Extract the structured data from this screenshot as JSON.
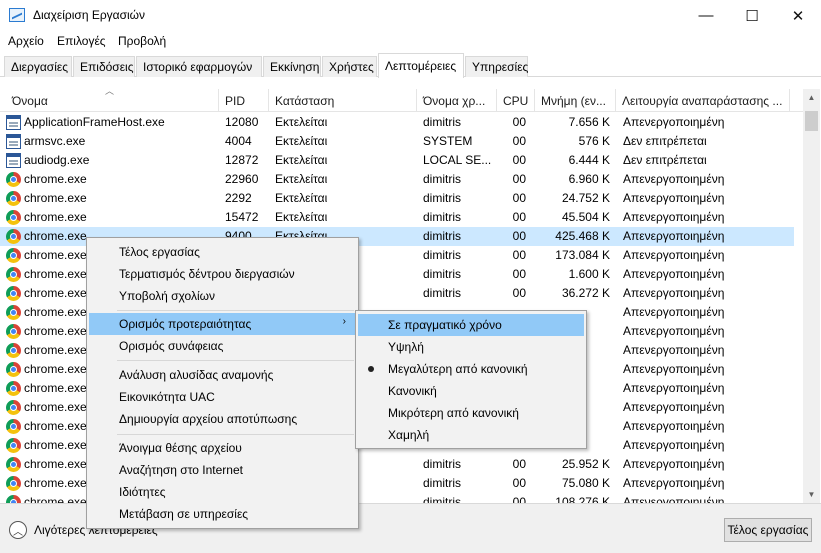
{
  "window": {
    "title": "Διαχείριση Εργασιών",
    "minimize": "—",
    "maximize": "☐",
    "close": "✕"
  },
  "menu": [
    "Αρχείο",
    "Επιλογές",
    "Προβολή"
  ],
  "tabs": [
    {
      "label": "Διεργασίες",
      "active": false
    },
    {
      "label": "Επιδόσεις",
      "active": false
    },
    {
      "label": "Ιστορικό εφαρμογών",
      "active": false
    },
    {
      "label": "Εκκίνηση",
      "active": false
    },
    {
      "label": "Χρήστες",
      "active": false
    },
    {
      "label": "Λεπτομέρειες",
      "active": true
    },
    {
      "label": "Υπηρεσίες",
      "active": false
    }
  ],
  "columns": [
    "Όνομα",
    "PID",
    "Κατάσταση",
    "Όνομα χρ...",
    "CPU",
    "Μνήμη (εν...",
    "Λειτουργία αναπαράστασης ..."
  ],
  "rows": [
    {
      "icon": "window-app-icon",
      "name": "ApplicationFrameHost.exe",
      "pid": "12080",
      "status": "Εκτελείται",
      "user": "dimitris",
      "cpu": "00",
      "mem": "7.656 K",
      "mode": "Απενεργοποιημένη"
    },
    {
      "icon": "window-app-icon",
      "name": "armsvc.exe",
      "pid": "4004",
      "status": "Εκτελείται",
      "user": "SYSTEM",
      "cpu": "00",
      "mem": "576 K",
      "mode": "Δεν επιτρέπεται"
    },
    {
      "icon": "window-app-icon",
      "name": "audiodg.exe",
      "pid": "12872",
      "status": "Εκτελείται",
      "user": "LOCAL SE...",
      "cpu": "00",
      "mem": "6.444 K",
      "mode": "Δεν επιτρέπεται"
    },
    {
      "icon": "chrome-icon",
      "name": "chrome.exe",
      "pid": "22960",
      "status": "Εκτελείται",
      "user": "dimitris",
      "cpu": "00",
      "mem": "6.960 K",
      "mode": "Απενεργοποιημένη"
    },
    {
      "icon": "chrome-icon",
      "name": "chrome.exe",
      "pid": "2292",
      "status": "Εκτελείται",
      "user": "dimitris",
      "cpu": "00",
      "mem": "24.752 K",
      "mode": "Απενεργοποιημένη"
    },
    {
      "icon": "chrome-icon",
      "name": "chrome.exe",
      "pid": "15472",
      "status": "Εκτελείται",
      "user": "dimitris",
      "cpu": "00",
      "mem": "45.504 K",
      "mode": "Απενεργοποιημένη"
    },
    {
      "icon": "chrome-icon",
      "name": "chrome.exe",
      "pid": "9400",
      "status": "Εκτελείται",
      "user": "dimitris",
      "cpu": "00",
      "mem": "425.468 K",
      "mode": "Απενεργοποιημένη",
      "selected": true
    },
    {
      "icon": "chrome-icon",
      "name": "chrome.exe",
      "pid": "",
      "status": "",
      "user": "dimitris",
      "cpu": "00",
      "mem": "173.084 K",
      "mode": "Απενεργοποιημένη"
    },
    {
      "icon": "chrome-icon",
      "name": "chrome.exe",
      "pid": "",
      "status": "",
      "user": "dimitris",
      "cpu": "00",
      "mem": "1.600 K",
      "mode": "Απενεργοποιημένη"
    },
    {
      "icon": "chrome-icon",
      "name": "chrome.exe",
      "pid": "",
      "status": "",
      "user": "dimitris",
      "cpu": "00",
      "mem": "36.272 K",
      "mode": "Απενεργοποιημένη"
    },
    {
      "icon": "chrome-icon",
      "name": "chrome.exe",
      "pid": "",
      "status": "",
      "user": "",
      "cpu": "",
      "mem": "",
      "mode": "Απενεργοποιημένη"
    },
    {
      "icon": "chrome-icon",
      "name": "chrome.exe",
      "pid": "",
      "status": "",
      "user": "",
      "cpu": "",
      "mem": "",
      "mode": "Απενεργοποιημένη"
    },
    {
      "icon": "chrome-icon",
      "name": "chrome.exe",
      "pid": "",
      "status": "",
      "user": "",
      "cpu": "",
      "mem": "",
      "mode": "Απενεργοποιημένη"
    },
    {
      "icon": "chrome-icon",
      "name": "chrome.exe",
      "pid": "",
      "status": "",
      "user": "",
      "cpu": "",
      "mem": "",
      "mode": "Απενεργοποιημένη"
    },
    {
      "icon": "chrome-icon",
      "name": "chrome.exe",
      "pid": "",
      "status": "",
      "user": "",
      "cpu": "",
      "mem": "",
      "mode": "Απενεργοποιημένη"
    },
    {
      "icon": "chrome-icon",
      "name": "chrome.exe",
      "pid": "",
      "status": "",
      "user": "",
      "cpu": "",
      "mem": "",
      "mode": "Απενεργοποιημένη"
    },
    {
      "icon": "chrome-icon",
      "name": "chrome.exe",
      "pid": "",
      "status": "",
      "user": "",
      "cpu": "",
      "mem": "",
      "mode": "Απενεργοποιημένη"
    },
    {
      "icon": "chrome-icon",
      "name": "chrome.exe",
      "pid": "",
      "status": "",
      "user": "",
      "cpu": "",
      "mem": "",
      "mode": "Απενεργοποιημένη"
    },
    {
      "icon": "chrome-icon",
      "name": "chrome.exe",
      "pid": "",
      "status": "",
      "user": "dimitris",
      "cpu": "00",
      "mem": "25.952 K",
      "mode": "Απενεργοποιημένη"
    },
    {
      "icon": "chrome-icon",
      "name": "chrome.exe",
      "pid": "",
      "status": "",
      "user": "dimitris",
      "cpu": "00",
      "mem": "75.080 K",
      "mode": "Απενεργοποιημένη"
    },
    {
      "icon": "chrome-icon",
      "name": "chrome.exe",
      "pid": "",
      "status": "",
      "user": "dimitris",
      "cpu": "00",
      "mem": "108.276 K",
      "mode": "Απενεργοποιημένη"
    }
  ],
  "context_menu": {
    "items": [
      {
        "label": "Τέλος εργασίας"
      },
      {
        "label": "Τερματισμός δέντρου διεργασιών"
      },
      {
        "label": "Υποβολή σχολίων"
      },
      {
        "label": "Ορισμός προτεραιότητας",
        "highlighted": true,
        "submenu": true
      },
      {
        "label": "Ορισμός συνάφειας"
      },
      {
        "label": "Ανάλυση αλυσίδας αναμονής"
      },
      {
        "label": "Εικονικότητα UAC"
      },
      {
        "label": "Δημιουργία αρχείου αποτύπωσης"
      },
      {
        "label": "Άνοιγμα θέσης αρχείου"
      },
      {
        "label": "Αναζήτηση στο Internet"
      },
      {
        "label": "Ιδιότητες"
      },
      {
        "label": "Μετάβαση σε υπηρεσίες"
      }
    ]
  },
  "priority_submenu": {
    "items": [
      {
        "label": "Σε πραγματικό χρόνο",
        "highlighted": true
      },
      {
        "label": "Υψηλή"
      },
      {
        "label": "Μεγαλύτερη από κανονική",
        "checked": true
      },
      {
        "label": "Κανονική"
      },
      {
        "label": "Μικρότερη από κανονική"
      },
      {
        "label": "Χαμηλή"
      }
    ]
  },
  "footer": {
    "fewer_details": "Λιγότερες λεπτομέρειες",
    "end_task": "Τέλος εργασίας"
  }
}
